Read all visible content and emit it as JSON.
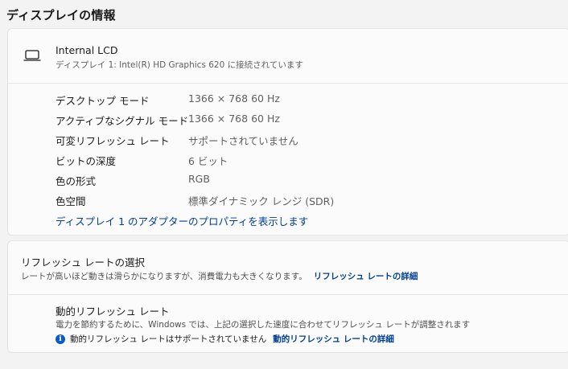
{
  "page": {
    "title": "ディスプレイの情報"
  },
  "display": {
    "icon": "laptop-icon",
    "name": "Internal LCD",
    "subtitle": "ディスプレイ 1: Intel(R) HD Graphics 620 に接続されています",
    "rows": [
      {
        "label": "デスクトップ モード",
        "value": "1366 × 768 60 Hz"
      },
      {
        "label": "アクティブなシグナル モード",
        "value": "1366 × 768 60 Hz"
      },
      {
        "label": "可変リフレッシュ レート",
        "value": "サポートされていません"
      },
      {
        "label": "ビットの深度",
        "value": "6 ビット"
      },
      {
        "label": "色の形式",
        "value": "RGB"
      },
      {
        "label": "色空間",
        "value": "標準ダイナミック レンジ (SDR)"
      }
    ],
    "adapter_link": "ディスプレイ 1 のアダプターのプロパティを表示します"
  },
  "refresh_rate": {
    "title": "リフレッシュ レートの選択",
    "description": "レートが高いほど動きは滑らかになりますが、消費電力も大きくなります。",
    "link": "リフレッシュ レートの詳細"
  },
  "dynamic_refresh": {
    "title": "動的リフレッシュ レート",
    "description": "電力を節約するために、Windows では、上記の選択した速度に合わせてリフレッシュ レートが調整されます",
    "note_icon": "info-icon",
    "note": "動的リフレッシュ レートはサポートされていません",
    "link": "動的リフレッシュ レートの詳細"
  },
  "colors": {
    "link": "#003e92",
    "info_icon": "#0a5cc2"
  }
}
